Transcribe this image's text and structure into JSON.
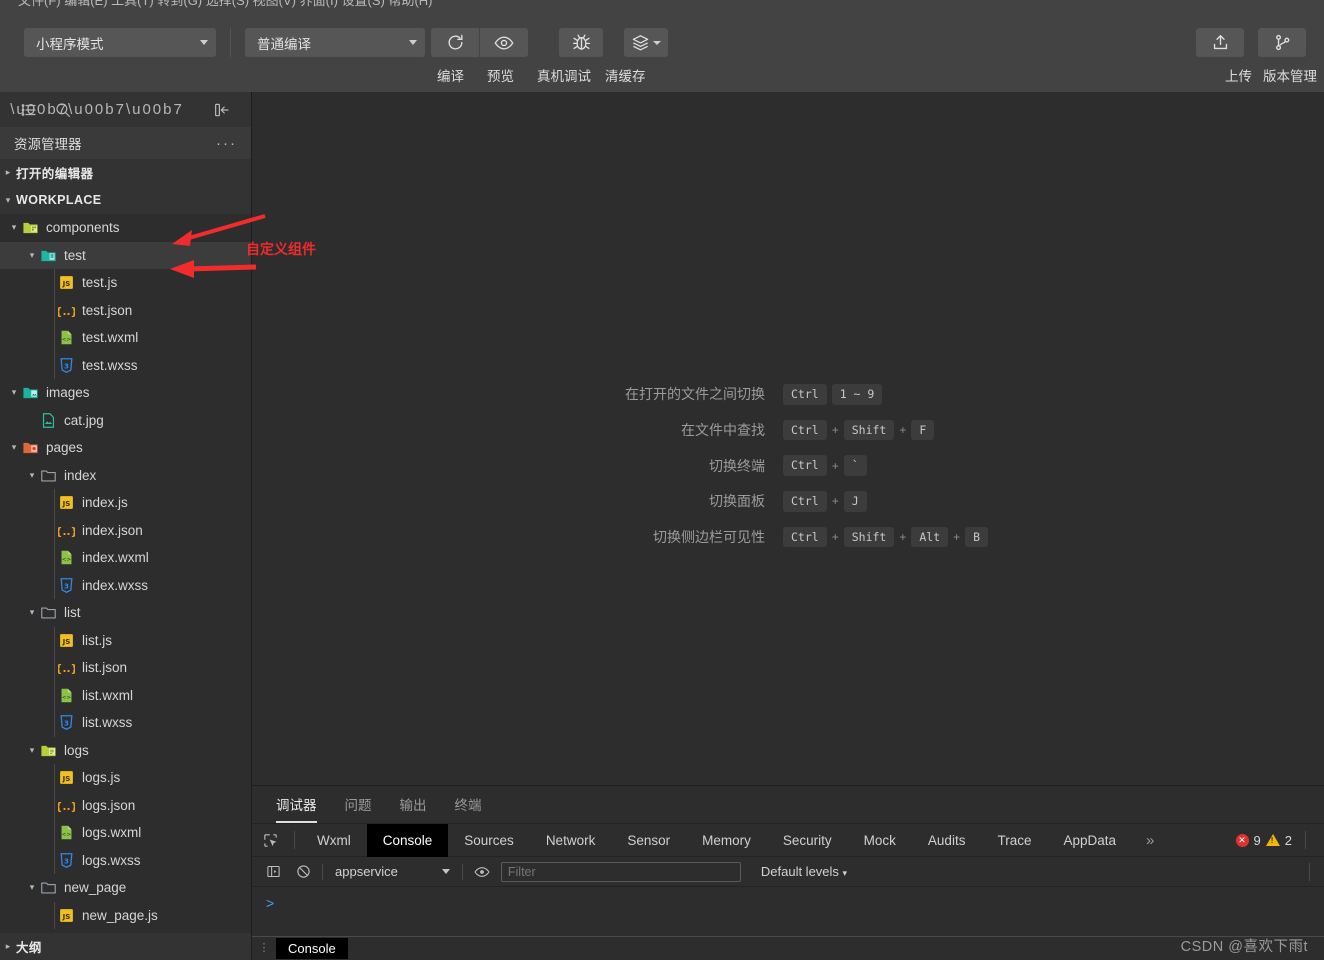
{
  "window": {
    "menustrip_text": "文件(F)  编辑(E)  工具(T)  转到(G)  选择(S)  视图(V)  界面(I)  设置(S)  帮助(H)"
  },
  "toolbar": {
    "mode_select": {
      "value": "小程序模式",
      "icon": "chevron-down-icon"
    },
    "compile_select": {
      "value": "普通编译",
      "icon": "chevron-down-icon"
    },
    "buttons": [
      {
        "id": "compile",
        "label": "编译",
        "icon": "refresh-icon"
      },
      {
        "id": "preview",
        "label": "预览",
        "icon": "eye-icon"
      },
      {
        "id": "remote-debug",
        "label": "真机调试",
        "icon": "bug-icon"
      },
      {
        "id": "clear-cache",
        "label": "清缓存",
        "icon": "layers-icon"
      }
    ],
    "right_buttons": [
      {
        "id": "upload",
        "label": "上传",
        "icon": "upload-icon"
      },
      {
        "id": "version",
        "label": "版本管理",
        "icon": "branch-icon"
      }
    ]
  },
  "sidebar": {
    "actions": [
      {
        "id": "explorer",
        "icon": "list-icon"
      },
      {
        "id": "search",
        "icon": "search-icon"
      },
      {
        "id": "more",
        "icon": "ellipsis-icon"
      },
      {
        "id": "collapse-sidebar",
        "icon": "collapse-panel-icon"
      }
    ],
    "explorer_title": "资源管理器",
    "explorer_more": "···",
    "sections": [
      {
        "label": "打开的编辑器",
        "expanded": false
      },
      {
        "label": "WORKPLACE",
        "expanded": true
      }
    ],
    "outline_label": "大纲",
    "tree": [
      {
        "label": "components",
        "type": "folder-components",
        "depth": 1,
        "expanded": true,
        "selected": false
      },
      {
        "label": "test",
        "type": "folder-component",
        "depth": 2,
        "expanded": true,
        "selected": true
      },
      {
        "label": "test.js",
        "type": "js",
        "depth": 3,
        "selected": false
      },
      {
        "label": "test.json",
        "type": "json",
        "depth": 3,
        "selected": false
      },
      {
        "label": "test.wxml",
        "type": "wxml",
        "depth": 3,
        "selected": false
      },
      {
        "label": "test.wxss",
        "type": "wxss",
        "depth": 3,
        "selected": false
      },
      {
        "label": "images",
        "type": "folder-images",
        "depth": 1,
        "expanded": true,
        "selected": false
      },
      {
        "label": "cat.jpg",
        "type": "image",
        "depth": 2,
        "selected": false
      },
      {
        "label": "pages",
        "type": "folder-pages",
        "depth": 1,
        "expanded": true,
        "selected": false
      },
      {
        "label": "index",
        "type": "folder-plain",
        "depth": 2,
        "expanded": true,
        "selected": false
      },
      {
        "label": "index.js",
        "type": "js",
        "depth": 3,
        "selected": false
      },
      {
        "label": "index.json",
        "type": "json",
        "depth": 3,
        "selected": false
      },
      {
        "label": "index.wxml",
        "type": "wxml",
        "depth": 3,
        "selected": false
      },
      {
        "label": "index.wxss",
        "type": "wxss",
        "depth": 3,
        "selected": false
      },
      {
        "label": "list",
        "type": "folder-plain",
        "depth": 2,
        "expanded": true,
        "selected": false
      },
      {
        "label": "list.js",
        "type": "js",
        "depth": 3,
        "selected": false
      },
      {
        "label": "list.json",
        "type": "json",
        "depth": 3,
        "selected": false
      },
      {
        "label": "list.wxml",
        "type": "wxml",
        "depth": 3,
        "selected": false
      },
      {
        "label": "list.wxss",
        "type": "wxss",
        "depth": 3,
        "selected": false
      },
      {
        "label": "logs",
        "type": "folder-logs",
        "depth": 2,
        "expanded": true,
        "selected": false
      },
      {
        "label": "logs.js",
        "type": "js",
        "depth": 3,
        "selected": false
      },
      {
        "label": "logs.json",
        "type": "json",
        "depth": 3,
        "selected": false
      },
      {
        "label": "logs.wxml",
        "type": "wxml",
        "depth": 3,
        "selected": false
      },
      {
        "label": "logs.wxss",
        "type": "wxss",
        "depth": 3,
        "selected": false
      },
      {
        "label": "new_page",
        "type": "folder-plain",
        "depth": 2,
        "expanded": true,
        "selected": false
      },
      {
        "label": "new_page.js",
        "type": "js",
        "depth": 3,
        "selected": false
      }
    ]
  },
  "editor": {
    "shortcuts": [
      {
        "label": "在打开的文件之间切换",
        "keys": [
          "Ctrl",
          "1 ~ 9"
        ],
        "joins": [
          ""
        ]
      },
      {
        "label": "在文件中查找",
        "keys": [
          "Ctrl",
          "Shift",
          "F"
        ],
        "joins": [
          "+",
          "+"
        ]
      },
      {
        "label": "切换终端",
        "keys": [
          "Ctrl",
          "`"
        ],
        "joins": [
          "+"
        ]
      },
      {
        "label": "切换面板",
        "keys": [
          "Ctrl",
          "J"
        ],
        "joins": [
          "+"
        ]
      },
      {
        "label": "切换侧边栏可见性",
        "keys": [
          "Ctrl",
          "Shift",
          "Alt",
          "B"
        ],
        "joins": [
          "+",
          "+",
          "+"
        ]
      }
    ]
  },
  "panel": {
    "tabs": [
      {
        "label": "调试器",
        "active": true
      },
      {
        "label": "问题",
        "active": false
      },
      {
        "label": "输出",
        "active": false
      },
      {
        "label": "终端",
        "active": false
      }
    ],
    "devtools_tabs": [
      {
        "label": "Wxml",
        "active": false
      },
      {
        "label": "Console",
        "active": true
      },
      {
        "label": "Sources",
        "active": false
      },
      {
        "label": "Network",
        "active": false
      },
      {
        "label": "Sensor",
        "active": false
      },
      {
        "label": "Memory",
        "active": false
      },
      {
        "label": "Security",
        "active": false
      },
      {
        "label": "Mock",
        "active": false
      },
      {
        "label": "Audits",
        "active": false
      },
      {
        "label": "Trace",
        "active": false
      },
      {
        "label": "AppData",
        "active": false
      }
    ],
    "devtools_overflow": "»",
    "status": {
      "error_count": "9",
      "warning_count": "2"
    },
    "console": {
      "context_value": "appservice",
      "filter_placeholder": "Filter",
      "filter_value": "",
      "levels_label": "Default levels",
      "prompt": ">"
    },
    "drawer_tab": "Console"
  },
  "annotations": [
    {
      "id": "custom-component-note",
      "text": "自定义组件"
    }
  ],
  "watermark": "CSDN @喜欢下雨t",
  "colors": {
    "toolbar_bg": "#434343",
    "editor_bg": "#2d2d2d",
    "sidebar_bg": "#2d2d2d",
    "accent_red": "#ef2b2b",
    "error": "#e03131",
    "warning": "#f0b90b"
  }
}
